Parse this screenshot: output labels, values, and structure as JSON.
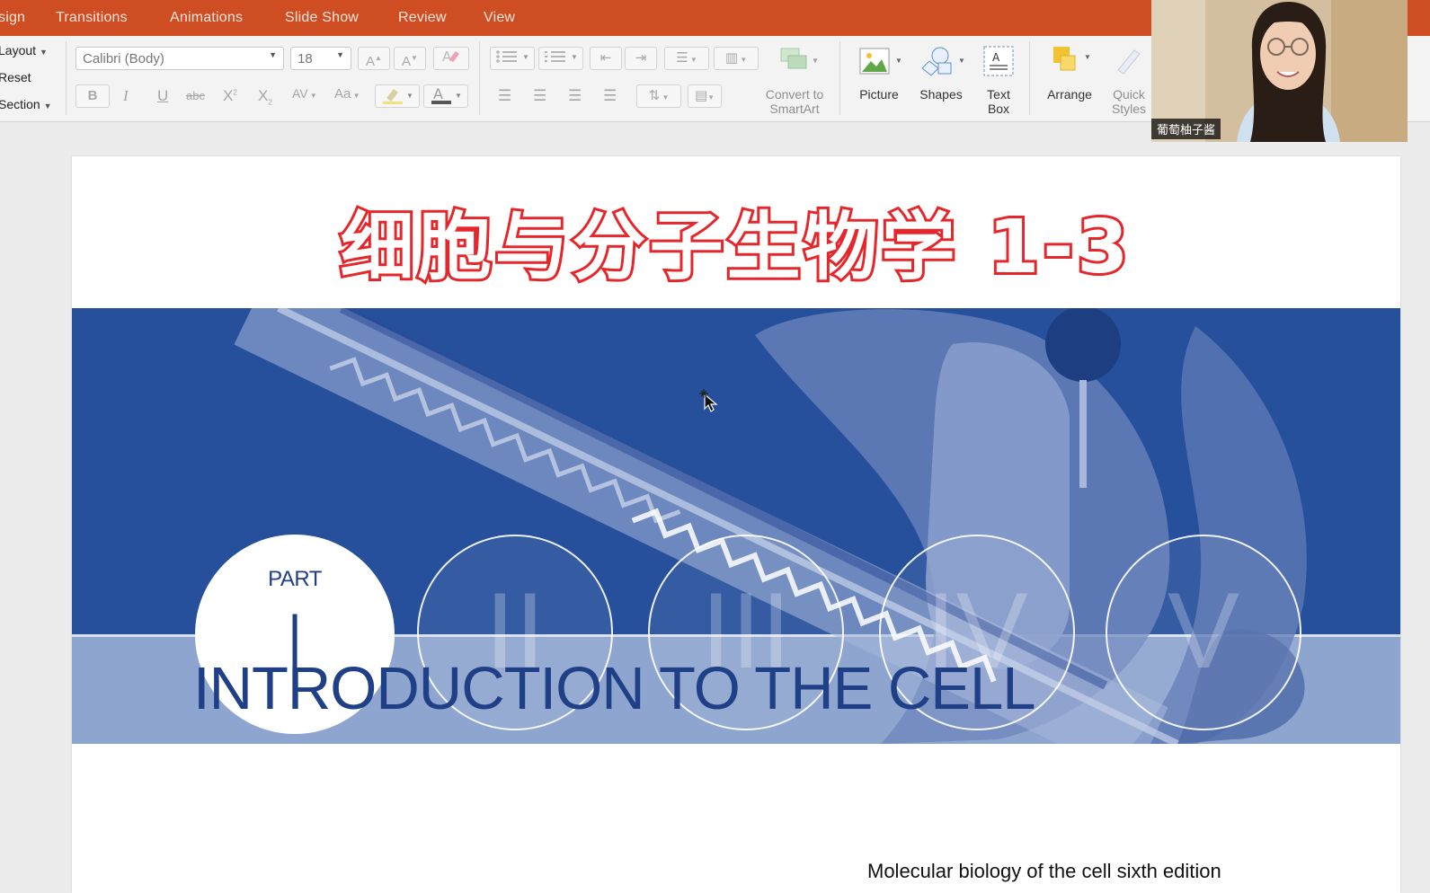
{
  "menu": {
    "items": [
      "sign",
      "Transitions",
      "Animations",
      "Slide Show",
      "Review",
      "View"
    ]
  },
  "ribbon": {
    "layout_label": "Layout",
    "reset_label": "Reset",
    "section_label": "Section",
    "font_name": "Calibri (Body)",
    "font_size": "18",
    "convert_label_1": "Convert to",
    "convert_label_2": "SmartArt",
    "picture_label": "Picture",
    "shapes_label": "Shapes",
    "textbox_label_1": "Text",
    "textbox_label_2": "Box",
    "arrange_label": "Arrange",
    "quick_styles_label_1": "Quick",
    "quick_styles_label_2": "Styles"
  },
  "webcam": {
    "name": "葡萄柚子酱"
  },
  "slide": {
    "overlay_title": "细胞与分子生物学 1-3",
    "part_label": "PART",
    "part_number": "I",
    "rings": [
      "II",
      "III",
      "IV",
      "V"
    ],
    "heading": "INTRODUCTION TO THE CELL",
    "caption": "Molecular biology of the cell sixth edition"
  },
  "colors": {
    "menubar": "#cf4d22",
    "banner_blue": "#26509c",
    "band_blue": "#8ea5cf",
    "title_red": "#e5262a"
  }
}
